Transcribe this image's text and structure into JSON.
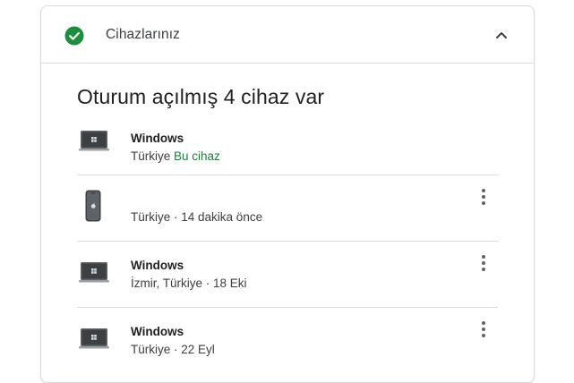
{
  "header": {
    "title": "Cihazlarınız",
    "status_icon": "check-circle-icon",
    "collapse_icon": "chevron-up-icon"
  },
  "section": {
    "title": "Oturum açılmış 4 cihaz var"
  },
  "devices": [
    {
      "icon": "laptop-windows-icon",
      "name": "Windows",
      "location": "Türkiye",
      "status": "Bu cihaz",
      "has_menu": false
    },
    {
      "icon": "iphone-icon",
      "name": "",
      "location": "Türkiye",
      "status": "14 dakika önce",
      "has_menu": true
    },
    {
      "icon": "laptop-windows-icon",
      "name": "Windows",
      "location": "İzmir, Türkiye",
      "status": "18 Eki",
      "has_menu": true
    },
    {
      "icon": "laptop-windows-icon",
      "name": "Windows",
      "location": "Türkiye",
      "status": "22 Eyl",
      "has_menu": true
    }
  ],
  "separator": " · ",
  "colors": {
    "accent_green": "#1e8e3e",
    "this_device_text": "#188038",
    "divider": "#dadce0"
  }
}
